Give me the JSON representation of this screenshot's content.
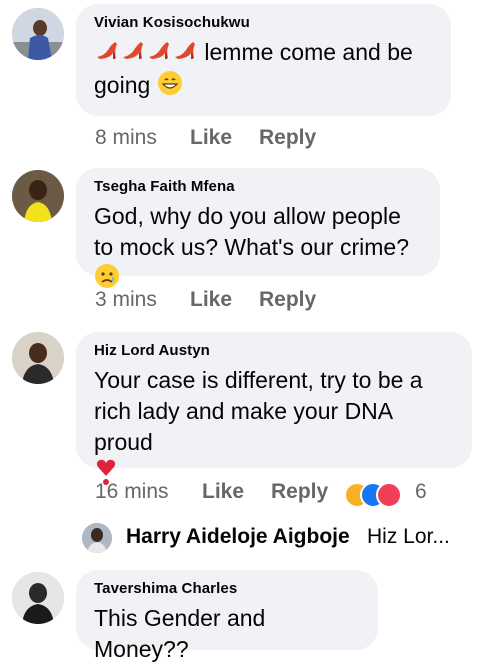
{
  "comments": [
    {
      "author": "Vivian Kosisochukwu",
      "text": "lemme come and be going",
      "emoji_leading": [
        "high-heel-shoe",
        "high-heel-shoe",
        "high-heel-shoe",
        "high-heel-shoe"
      ],
      "emoji_trailing": "grinning-face",
      "time": "8 mins",
      "like_label": "Like",
      "reply_label": "Reply"
    },
    {
      "author": "Tsegha Faith Mfena",
      "text": "God, why do you allow people to mock us? What's our crime?",
      "emoji_trailing": "sad-but-relieved-face",
      "time": "3 mins",
      "like_label": "Like",
      "reply_label": "Reply"
    },
    {
      "author": "Hiz Lord Austyn",
      "text": "Your case is different, try to be a rich lady and make your DNA proud",
      "emoji_trailing": "red-exclamation-heart",
      "time": "16 mins",
      "like_label": "Like",
      "reply_label": "Reply",
      "reactions": [
        "haha",
        "like",
        "love"
      ],
      "reaction_count": "6",
      "reply_preview": {
        "name": "Harry Aideloje Aigboje",
        "text": "Hiz Lor..."
      }
    },
    {
      "author": "Tavershima Charles",
      "text": "This Gender and Money??"
    }
  ],
  "colors": {
    "bubble": "#f0f2f5",
    "meta_text": "#65676b",
    "like_reaction": "#1877f2",
    "love_reaction": "#f33e58",
    "haha_reaction": "#f7b125"
  }
}
